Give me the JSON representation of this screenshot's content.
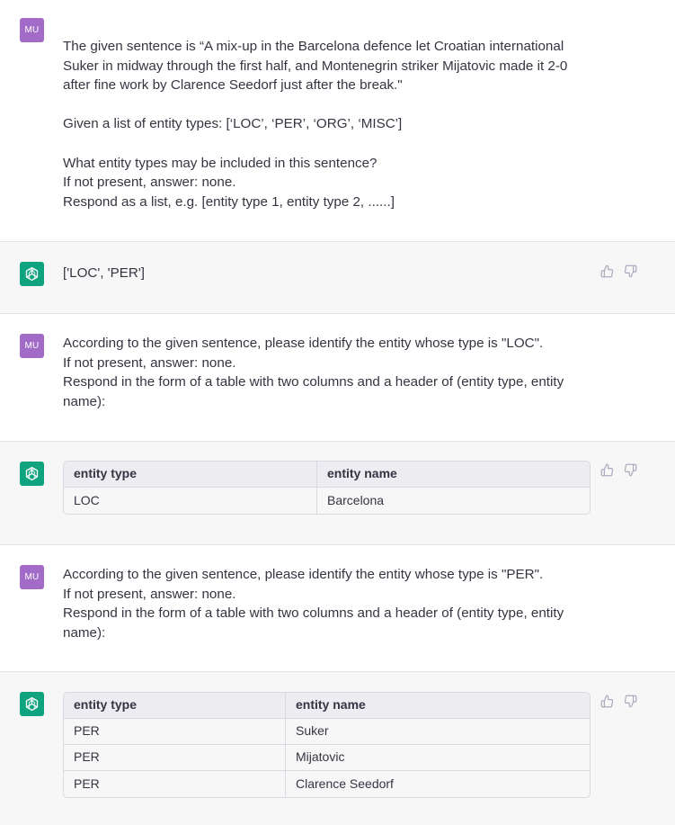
{
  "messages": [
    {
      "role": "user",
      "avatar": "MU",
      "paragraphs": [
        "The given sentence is “A mix-up in the Barcelona defence let Croatian international Suker in midway through the first half, and Montenegrin striker Mijatovic made it 2-0 after fine work by Clarence Seedorf just after the break.\"",
        "Given a list of entity types: [‘LOC’, ‘PER’, ‘ORG’, ‘MISC’]",
        "What entity types may be included in this sentence?\nIf not present, answer: none.\nRespond as a list, e.g. [entity type 1, entity type 2, ......]"
      ]
    },
    {
      "role": "assistant",
      "avatar_icon": "openai-logo-icon",
      "text": "['LOC', 'PER']",
      "feedback_icons": [
        "thumbs-up-icon",
        "thumbs-down-icon"
      ]
    },
    {
      "role": "user",
      "avatar": "MU",
      "text": "According to the given sentence, please identify the entity whose type is \"LOC\".\nIf not present, answer: none.\nRespond in the form of a table with two columns and a header of (entity type, entity name):"
    },
    {
      "role": "assistant",
      "avatar_icon": "openai-logo-icon",
      "table": {
        "headers": [
          "entity type",
          "entity name"
        ],
        "rows": [
          [
            "LOC",
            "Barcelona"
          ]
        ]
      }
    },
    {
      "role": "user",
      "avatar": "MU",
      "text": "According to the given sentence, please identify the entity whose type is \"PER\".\nIf not present, answer: none.\nRespond in the form of a table with two columns and a header of (entity type, entity name):"
    },
    {
      "role": "assistant",
      "avatar_icon": "openai-logo-icon",
      "table": {
        "headers": [
          "entity type",
          "entity name"
        ],
        "rows": [
          [
            "PER",
            "Suker"
          ],
          [
            "PER",
            "Mijatovic"
          ],
          [
            "PER",
            "Clarence Seedorf"
          ]
        ]
      }
    }
  ],
  "colors": {
    "user_avatar": "#a26bc7",
    "assistant_avatar": "#10a37f",
    "assistant_bg": "#f7f7f8",
    "user_bg": "#ffffff",
    "text": "#343541"
  }
}
